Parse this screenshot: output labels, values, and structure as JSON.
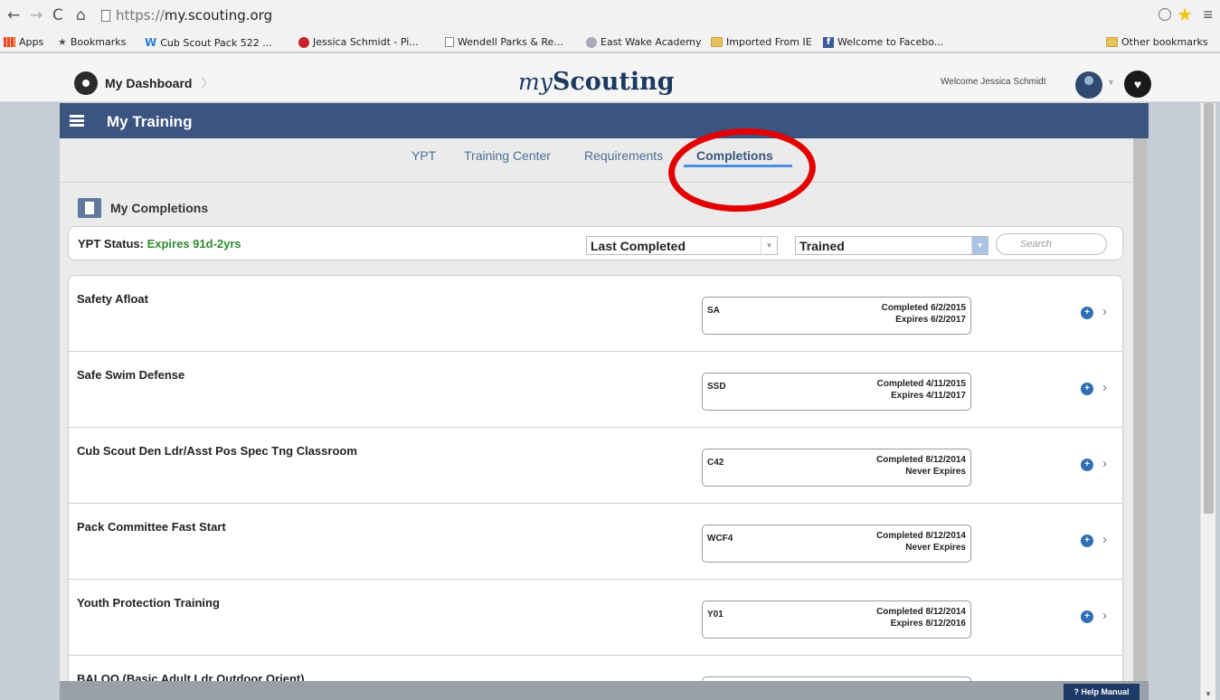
{
  "browser": {
    "url_protocol": "https://",
    "url_host": "my.scouting.org",
    "bookmarks": [
      {
        "label": "Apps",
        "icon": "apps-icon"
      },
      {
        "label": "Bookmarks",
        "icon": "star-icon"
      },
      {
        "label": "Cub Scout Pack 522 ...",
        "icon": "w-icon"
      },
      {
        "label": "Jessica Schmidt - Pi...",
        "icon": "pinterest-icon"
      },
      {
        "label": "Wendell Parks & Re...",
        "icon": "file-icon"
      },
      {
        "label": "East Wake Academy",
        "icon": "globe-icon"
      },
      {
        "label": "Imported From IE",
        "icon": "folder-icon"
      },
      {
        "label": "Welcome to Facebo...",
        "icon": "facebook-icon"
      },
      {
        "label": "Other bookmarks",
        "icon": "folder-icon"
      }
    ]
  },
  "header": {
    "dashboard_label": "My Dashboard",
    "logo_my": "my",
    "logo_name": "Scouting",
    "welcome": "Welcome Jessica Schmidt"
  },
  "training": {
    "title": "My Training",
    "tabs": [
      {
        "label": "YPT"
      },
      {
        "label": "Training Center"
      },
      {
        "label": "Requirements"
      },
      {
        "label": "Completions"
      }
    ],
    "section_title": "My Completions",
    "ypt_label": "YPT Status:",
    "ypt_value": "Expires 91d-2yrs",
    "sort_select": "Last Completed",
    "filter_select": "Trained",
    "search_placeholder": "Search",
    "rows": [
      {
        "name": "Safety Afloat",
        "code": "SA",
        "completed": "Completed 6/2/2015",
        "expires": "Expires 6/2/2017"
      },
      {
        "name": "Safe Swim Defense",
        "code": "SSD",
        "completed": "Completed 4/11/2015",
        "expires": "Expires 4/11/2017"
      },
      {
        "name": "Cub Scout Den Ldr/Asst Pos Spec Tng Classroom",
        "code": "C42",
        "completed": "Completed 8/12/2014",
        "expires": "Never Expires"
      },
      {
        "name": "Pack Committee Fast Start",
        "code": "WCF4",
        "completed": "Completed 8/12/2014",
        "expires": "Never Expires"
      },
      {
        "name": "Youth Protection Training",
        "code": "Y01",
        "completed": "Completed 8/12/2014",
        "expires": "Expires 8/12/2016"
      },
      {
        "name": "BALOO (Basic Adult Ldr Outdoor Orient)",
        "code": "",
        "completed": "",
        "expires": ""
      }
    ],
    "help_label": "Help Manual"
  },
  "colors": {
    "title_bar": "#3b5480",
    "tab_link": "#4d6f96",
    "active_underline": "#4a90e2",
    "ypt_status": "#2e8b2e",
    "annotation_ring": "#e40000"
  }
}
